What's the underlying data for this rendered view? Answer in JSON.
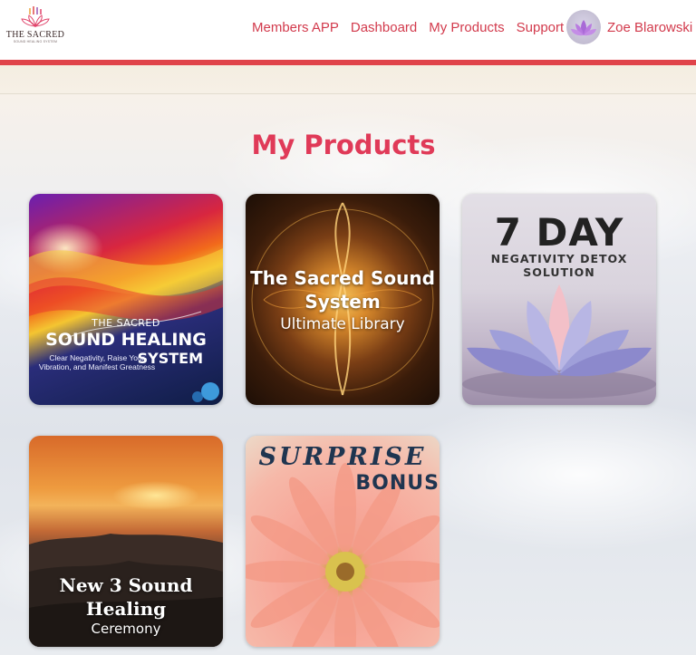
{
  "brand": {
    "logo_title": "THE SACRED",
    "logo_subtitle": "SOUND HEALING SYSTEM"
  },
  "nav": {
    "items": [
      {
        "label": "Members APP"
      },
      {
        "label": "Dashboard"
      },
      {
        "label": "My Products"
      },
      {
        "label": "Support"
      }
    ]
  },
  "user": {
    "name": "Zoe Blarowski",
    "avatar_icon": "lotus-icon"
  },
  "main": {
    "title": "My Products"
  },
  "products": [
    {
      "line1": "THE SACRED",
      "line2": "SOUND HEALING",
      "line3": "SYSTEM",
      "line4": "Clear Negativity, Raise Your Vibration, and Manifest Greatness"
    },
    {
      "line1": "The Sacred Sound System",
      "line2": "Ultimate Library"
    },
    {
      "line1": "7 DAY",
      "line2": "NEGATIVITY DETOX SOLUTION"
    },
    {
      "line1": "New 3 Sound Healing",
      "line2": "Ceremony"
    },
    {
      "line1": "SURPRISE",
      "line2": "BONUS"
    }
  ],
  "colors": {
    "accent": "#d23a4c",
    "title": "#e03a58",
    "header_rule": "#e0434a"
  }
}
